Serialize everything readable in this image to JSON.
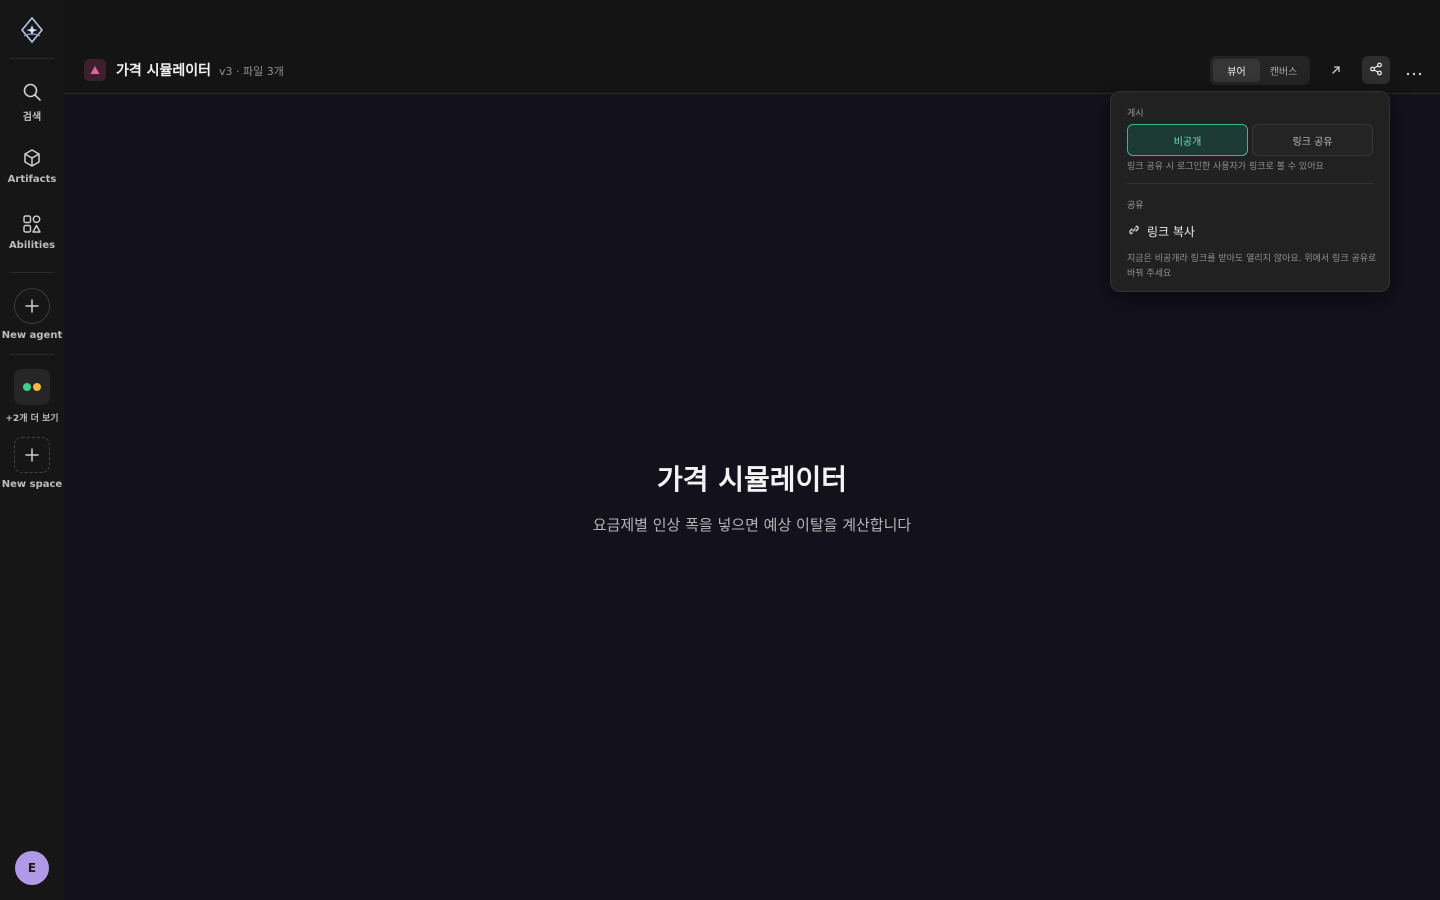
{
  "sidebar": {
    "items": [
      {
        "label": "검색",
        "icon": "search-icon"
      },
      {
        "label": "Artifacts",
        "icon": "cube-icon"
      },
      {
        "label": "Abilities",
        "icon": "shapes-icon"
      }
    ],
    "new_agent_label": "New agent",
    "more_spaces_label": "+2개 더 보기",
    "new_space_label": "New space",
    "avatar_initial": "E",
    "space_dot_colors": [
      "#3ecf8e",
      "#f4b740"
    ]
  },
  "header": {
    "title": "가격 시뮬레이터",
    "meta": "v3 · 파일 3개",
    "view_tabs": [
      {
        "label": "뷰어",
        "active": true
      },
      {
        "label": "캔버스",
        "active": false
      }
    ]
  },
  "main": {
    "title": "가격 시뮬레이터",
    "subtitle": "요금제별 인상 폭을 넣으면 예상 이탈을 계산합니다"
  },
  "share_popover": {
    "publish_heading": "게시",
    "options": [
      {
        "label": "비공개",
        "selected": true
      },
      {
        "label": "링크 공유",
        "selected": false
      }
    ],
    "publish_note": "링크 공유 시 로그인한 사용자가 링크로 볼 수 있어요",
    "share_heading": "공유",
    "copy_link_label": "링크 복사",
    "copy_note": "지금은 비공개라 링크를 받아도 열리지 않아요. 위에서 링크 공유로 바꿔 주세요"
  },
  "colors": {
    "accent": "#3fb393",
    "doc_icon": "#e0629e",
    "avatar": "#b09ae8"
  }
}
